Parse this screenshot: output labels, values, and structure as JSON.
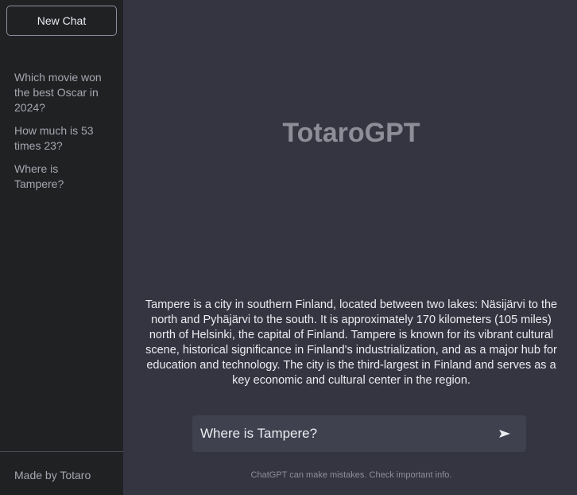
{
  "sidebar": {
    "new_chat_label": "New Chat",
    "history": [
      "Which movie won the best Oscar in 2024?",
      "How much is 53 times 23?",
      "Where is Tampere?"
    ],
    "footer": "Made by Totaro"
  },
  "main": {
    "brand": "TotaroGPT",
    "answer": "Tampere is a city in southern Finland, located between two lakes: Näsijärvi to the north and Pyhäjärvi to the south. It is approximately 170 kilometers (105 miles) north of Helsinki, the capital of Finland. Tampere is known for its vibrant cultural scene, historical significance in Finland's industrialization, and as a major hub for education and technology. The city is the third-largest in Finland and serves as a key economic and cultural center in the region.",
    "input_value": "Where is Tampere?",
    "send_icon": "send-arrow-icon",
    "disclaimer": "ChatGPT can make mistakes. Check important info."
  },
  "colors": {
    "main_bg": "#343541",
    "sidebar_bg": "#202123",
    "input_bg": "#40414f"
  }
}
